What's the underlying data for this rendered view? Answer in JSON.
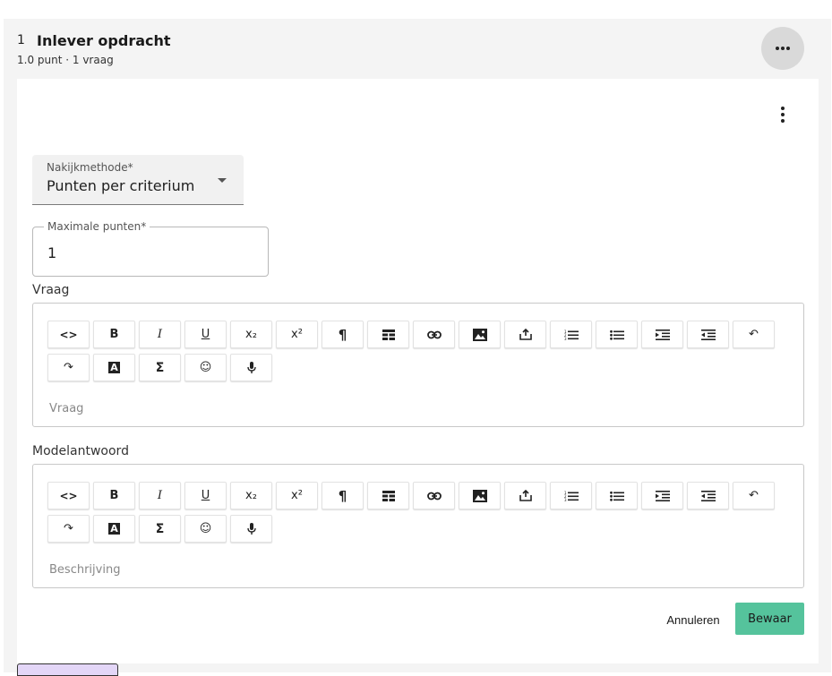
{
  "section": {
    "number": "1",
    "title": "Inlever opdracht",
    "meta": "1.0 punt · 1 vraag"
  },
  "form": {
    "grading_method": {
      "label": "Nakijkmethode*",
      "value": "Punten per criterium"
    },
    "max_points": {
      "label": "Maximale punten*",
      "value": "1"
    }
  },
  "question": {
    "title": "Vraag",
    "placeholder": "Vraag"
  },
  "model_answer": {
    "title": "Modelantwoord",
    "placeholder": "Beschrijving"
  },
  "toolbar": {
    "buttons": [
      {
        "name": "code",
        "glyph": "<>"
      },
      {
        "name": "bold",
        "glyph": "B"
      },
      {
        "name": "italic",
        "glyph": "I"
      },
      {
        "name": "underline",
        "glyph": "U"
      },
      {
        "name": "subscript",
        "glyph": "x₂"
      },
      {
        "name": "superscript",
        "glyph": "x²"
      },
      {
        "name": "paragraph",
        "glyph": "¶"
      },
      {
        "name": "table",
        "glyph": "table"
      },
      {
        "name": "link",
        "glyph": "link"
      },
      {
        "name": "image",
        "glyph": "image"
      },
      {
        "name": "upload",
        "glyph": "upload"
      },
      {
        "name": "ordered-list",
        "glyph": "ol"
      },
      {
        "name": "bullet-list",
        "glyph": "ul"
      },
      {
        "name": "indent",
        "glyph": "indent"
      },
      {
        "name": "outdent",
        "glyph": "outdent"
      },
      {
        "name": "undo",
        "glyph": "↶"
      },
      {
        "name": "redo",
        "glyph": "↷"
      },
      {
        "name": "text-color",
        "glyph": "A"
      },
      {
        "name": "formula",
        "glyph": "Σ"
      },
      {
        "name": "emoji",
        "glyph": "☺"
      },
      {
        "name": "microphone",
        "glyph": "mic"
      }
    ]
  },
  "actions": {
    "cancel": "Annuleren",
    "save": "Bewaar"
  },
  "colors": {
    "save_button": "#55c39c",
    "background": "#f4f4f4",
    "partial_tab": "#e3d6f7"
  }
}
